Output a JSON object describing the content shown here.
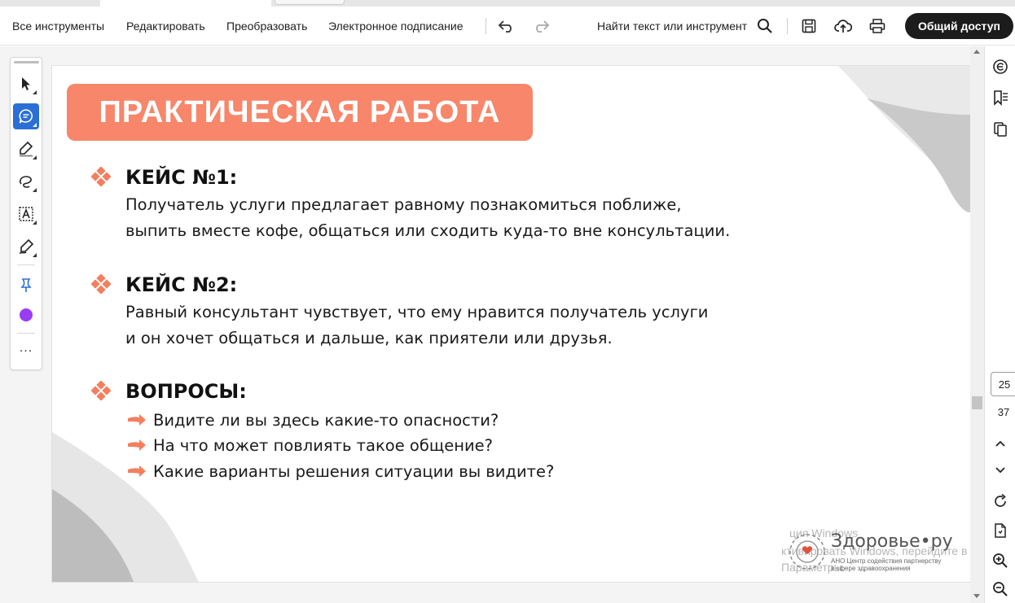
{
  "toolbar": {
    "menu": [
      "Все инструменты",
      "Редактировать",
      "Преобразовать",
      "Электронное подписание"
    ],
    "search_label": "Найти текст или инструмент",
    "share_label": "Общий доступ",
    "icons": [
      "undo-icon",
      "redo-icon",
      "search-icon",
      "save-icon",
      "upload-icon",
      "print-icon"
    ]
  },
  "tools": {
    "items": [
      "select-cursor-icon",
      "comment-icon",
      "highlight-icon",
      "draw-lasso-icon",
      "text-box-icon",
      "sign-pen-icon",
      "pin-icon"
    ],
    "active": "comment-icon",
    "color": "#9a3cf0",
    "more_label": "···"
  },
  "slide": {
    "banner": "ПРАКТИЧЕСКАЯ РАБОТА",
    "banner_color": "#f7866a",
    "case1": {
      "heading": "КЕЙС №1:",
      "lines": [
        "Получатель услуги предлагает равному познакомиться поближе,",
        "выпить вместе кофе, общаться или сходить куда-то вне консультации."
      ]
    },
    "case2": {
      "heading": "КЕЙС №2:",
      "lines": [
        "Равный консультант чувствует, что ему нравится получатель услуги",
        "и он хочет общаться и дальше, как приятели или друзья."
      ]
    },
    "questions": {
      "heading": "ВОПРОСЫ:",
      "items": [
        "Видите ли вы здесь какие-то опасности?",
        "На что может повлиять такое общение?",
        "Какие варианты решения ситуации вы видите?"
      ]
    },
    "logo": {
      "name": "Здоровье•ру",
      "sub1": "АНО Центр содействия партнерству",
      "sub2": "в сфере здравоохранения"
    },
    "watermark": [
      "ция Windows",
      "ктивировать Windows, перейдите в",
      "Параметры."
    ]
  },
  "navigation": {
    "current_page": "25",
    "total_pages": "37"
  },
  "right_rail": {
    "icons": [
      "ai-assistant-icon",
      "bookmark-list-icon",
      "copy-pages-icon",
      "chevron-up-icon",
      "chevron-down-icon",
      "refresh-icon",
      "page-export-icon",
      "zoom-in-icon",
      "zoom-out-icon"
    ]
  }
}
